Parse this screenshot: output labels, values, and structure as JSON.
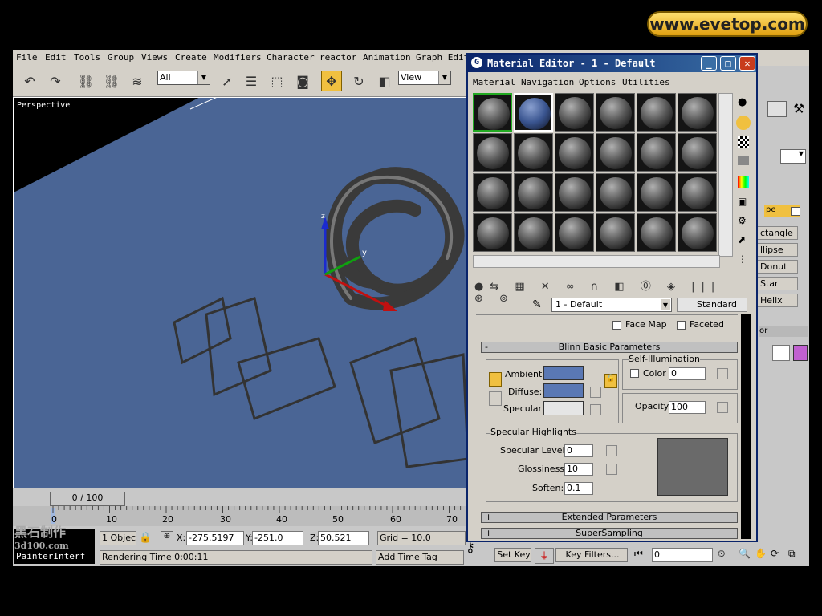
{
  "menubar": [
    "File",
    "Edit",
    "Tools",
    "Group",
    "Views",
    "Create",
    "Modifiers",
    "Character",
    "reactor",
    "Animation",
    "Graph Edit"
  ],
  "toolbar": {
    "selection_filter": "All",
    "ref_coord": "View"
  },
  "viewport": {
    "label": "Perspective",
    "object_label": "y"
  },
  "command_panel": {
    "buttons": [
      "ctangle",
      "llipse",
      "Donut",
      "Star",
      "Helix"
    ],
    "label_a": "pe",
    "label_b": "or"
  },
  "timeline": {
    "slider": "0 / 100",
    "ticks": [
      "0",
      "10",
      "20",
      "30",
      "40",
      "50",
      "60",
      "70"
    ]
  },
  "status": {
    "objects": "1 Objec",
    "x_label": "X:",
    "x": "-275.5197",
    "y_label": "Y:",
    "y": "-251.0",
    "z_label": "Z:",
    "z": "50.521",
    "grid": "Grid = 10.0",
    "rendering": "Rendering Time  0:00:11",
    "add_time_tag": "Add Time Tag",
    "set_key": "Set Key",
    "key_filters": "Key Filters...",
    "frame": "0",
    "left_label": "PainterInterf"
  },
  "material_editor": {
    "title": "Material Editor - 1 - Default",
    "menu": [
      "Material",
      "Navigation",
      "Options",
      "Utilities"
    ],
    "material_name": "1 - Default",
    "material_type": "Standard",
    "face_map": "Face Map",
    "faceted": "Faceted",
    "blinn_title": "Blinn Basic Parameters",
    "self_illum": "Self-Illumination",
    "color_label": "Color",
    "color_value": "0",
    "ambient": "Ambient:",
    "diffuse": "Diffuse:",
    "specular": "Specular:",
    "opacity_label": "Opacity:",
    "opacity": "100",
    "spec_highlights": "Specular Highlights",
    "spec_level_label": "Specular Level:",
    "spec_level": "0",
    "glossiness_label": "Glossiness:",
    "glossiness": "10",
    "soften_label": "Soften:",
    "soften": "0.1",
    "extended": "Extended Parameters",
    "supersampling": "SuperSampling",
    "ambient_color": "#5a78b4",
    "diffuse_color": "#5a78b4",
    "specular_color": "#e5e5e5"
  },
  "watermark": {
    "line1": "黑石制作",
    "line2": "3d100.com"
  },
  "logo": "www.evetop.com",
  "colors": {
    "viewport_bg": "#4a6595",
    "accent": "#0a246a"
  }
}
